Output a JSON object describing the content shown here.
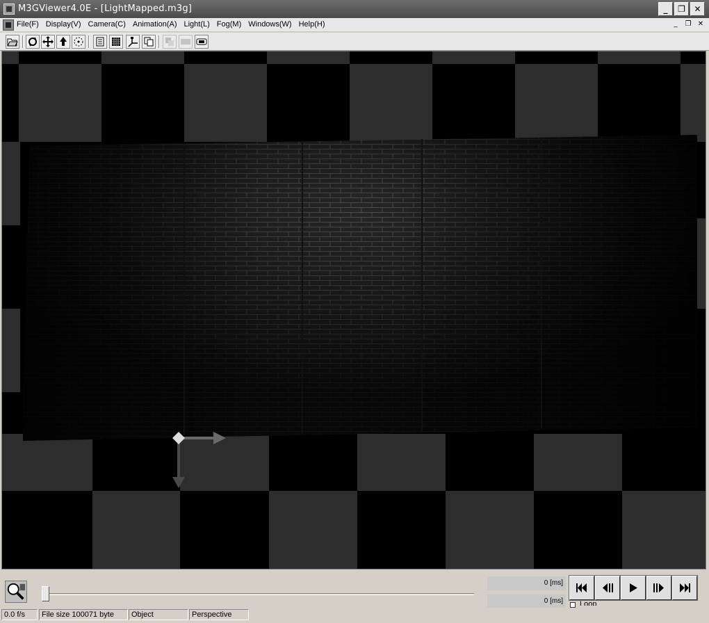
{
  "window": {
    "title": "M3GViewer4.0E  - [LightMapped.m3g]",
    "buttons": {
      "minimize": "_",
      "maximize": "❐",
      "close": "✕"
    }
  },
  "menu": {
    "items": [
      "File(F)",
      "Display(V)",
      "Camera(C)",
      "Animation(A)",
      "Light(L)",
      "Fog(M)",
      "Windows(W)",
      "Help(H)"
    ],
    "mdi_buttons": {
      "minimize": "_",
      "restore": "❐",
      "close": "✕"
    }
  },
  "toolbar": {
    "icons": [
      "open-folder-icon",
      "rotate-icon",
      "move-icon",
      "zoom-icon",
      "target-icon",
      "page-icon",
      "grid-icon",
      "axes-icon",
      "copy-icon",
      "layers-icon",
      "gradient-icon",
      "film-icon"
    ]
  },
  "timeline": {
    "position": 0.0,
    "current_time": "0 [ms]",
    "total_time": "0 [ms]",
    "loop_label": "Loop"
  },
  "status": {
    "fps": "0.0  f/s",
    "file_size": "File size 100071 byte",
    "mode": "Object",
    "projection": "Perspective"
  },
  "colors": {
    "titlebar": "#5a5a5a",
    "chrome": "#d4d0c8",
    "checker_light": "#2d2d2d",
    "checker_dark": "#000000"
  }
}
